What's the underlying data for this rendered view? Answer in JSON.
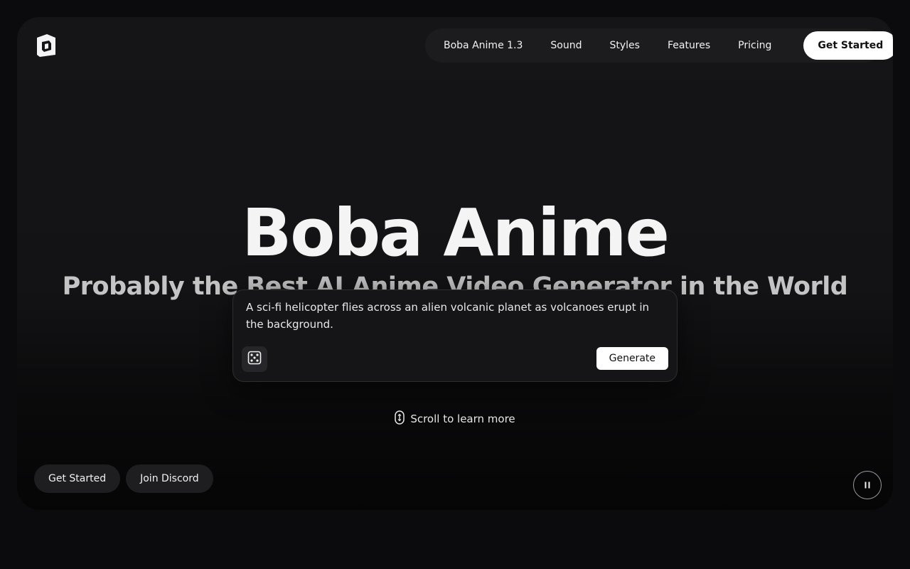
{
  "header": {
    "logo_icon": "boba-logo-icon",
    "nav": {
      "items": [
        {
          "label": "Boba Anime 1.3"
        },
        {
          "label": "Sound"
        },
        {
          "label": "Styles"
        },
        {
          "label": "Features"
        },
        {
          "label": "Pricing"
        }
      ],
      "cta_label": "Get Started"
    }
  },
  "hero": {
    "title": "Boba Anime",
    "subtitle": "Probably the Best AI Anime Video Generator in the World"
  },
  "prompt": {
    "text": "A sci-fi helicopter flies across an alien volcanic planet as volcanoes erupt in the background.",
    "random_icon": "dice-icon",
    "generate_label": "Generate"
  },
  "scroll_hint": {
    "icon": "mouse-scroll-icon",
    "label": "Scroll to learn more"
  },
  "footer_actions": {
    "get_started_label": "Get Started",
    "discord_label": "Join Discord",
    "pause_icon": "pause-icon"
  },
  "colors": {
    "page_bg": "#0b0b0d",
    "hero_bg": "#151517",
    "nav_bg": "#1c1c1f",
    "cta_bg": "#ffffff"
  }
}
